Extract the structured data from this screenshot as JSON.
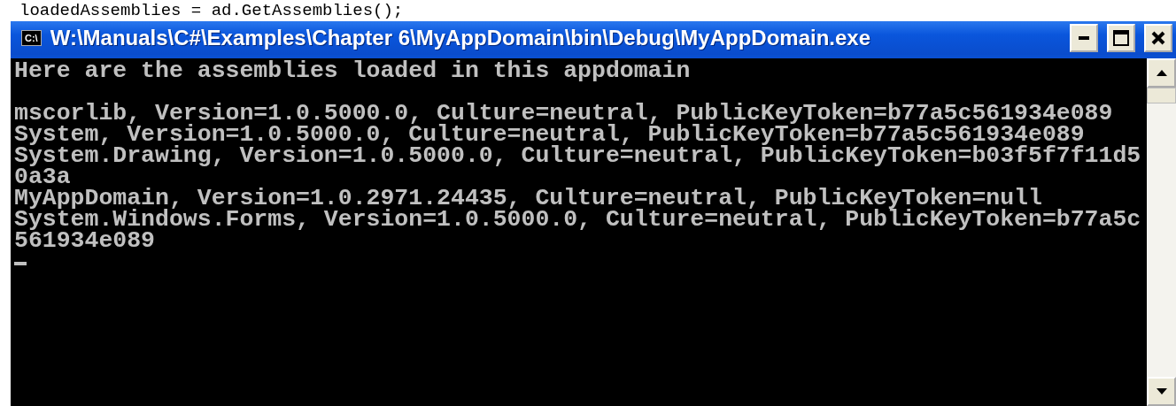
{
  "background_code": "loadedAssemblies = ad.GetAssemblies();",
  "window": {
    "title": "W:\\Manuals\\C#\\Examples\\Chapter 6\\MyAppDomain\\bin\\Debug\\MyAppDomain.exe",
    "icon_text": "C:\\"
  },
  "console": {
    "heading": "Here are the assemblies loaded in this appdomain",
    "lines": [
      "mscorlib, Version=1.0.5000.0, Culture=neutral, PublicKeyToken=b77a5c561934e089",
      "System, Version=1.0.5000.0, Culture=neutral, PublicKeyToken=b77a5c561934e089",
      "System.Drawing, Version=1.0.5000.0, Culture=neutral, PublicKeyToken=b03f5f7f11d5",
      "0a3a",
      "MyAppDomain, Version=1.0.2971.24435, Culture=neutral, PublicKeyToken=null",
      "System.Windows.Forms, Version=1.0.5000.0, Culture=neutral, PublicKeyToken=b77a5c",
      "561934e089"
    ]
  }
}
